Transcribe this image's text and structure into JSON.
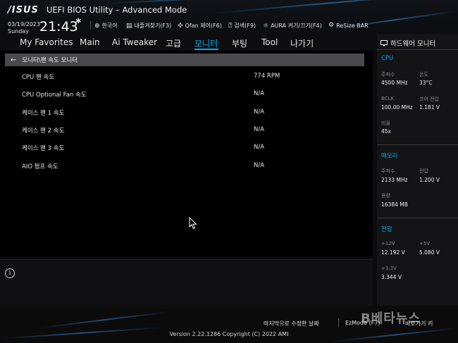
{
  "header": {
    "logo": "/ISUS",
    "title": "UEFI BIOS Utility – Advanced Mode",
    "date": "03/19/2023",
    "day": "Sunday",
    "time": "21:43",
    "icons": {
      "settings": "gear-icon"
    },
    "items": [
      {
        "icon": "globe-icon",
        "label": "한국어"
      },
      {
        "icon": "bookmark-icon",
        "label": "내즐겨찾기(F3)"
      },
      {
        "icon": "fan-icon",
        "label": "Qfan 제어(F6)"
      },
      {
        "icon": "help-icon",
        "label": "검색(F9)"
      },
      {
        "icon": "aura-icon",
        "label": "AURA 켜기/끄기(F4)"
      },
      {
        "icon": "resize-bar-icon",
        "label": "ReSize BAR"
      }
    ]
  },
  "menu": {
    "tabs": [
      "My Favorites",
      "Main",
      "Ai Tweaker",
      "고급",
      "모니터",
      "부팅",
      "Tool",
      "나가기"
    ],
    "active": "모니터"
  },
  "main": {
    "breadcrumb": "모니터\\팬 속도 모니터",
    "rows": [
      {
        "label": "CPU 팬 속도",
        "value": "774 RPM"
      },
      {
        "label": "CPU Optional Fan 속도",
        "value": "N/A"
      },
      {
        "label": "케이스 팬 1 속도",
        "value": "N/A"
      },
      {
        "label": "케이스 팬 2 속도",
        "value": "N/A"
      },
      {
        "label": "케이스 팬 3 속도",
        "value": "N/A"
      },
      {
        "label": "AIO 펌프 속도",
        "value": "N/A"
      }
    ]
  },
  "help": {
    "icon": "info-icon",
    "glyph": "i"
  },
  "hardware_monitor": {
    "title": "하드웨어 모니터",
    "cpu": {
      "title": "CPU",
      "freq_label": "주파수",
      "freq": "4500 MHz",
      "temp_label": "온도",
      "temp": "33°C",
      "bclk_label": "BCLK",
      "bclk": "100.00 MHz",
      "vcore_label": "코어 전압",
      "vcore": "1.181 V",
      "ratio_label": "비율",
      "ratio": "45x"
    },
    "memory": {
      "title": "메모리",
      "freq_label": "주파수",
      "freq": "2133 MHz",
      "volt_label": "전압",
      "volt": "1.200 V",
      "cap_label": "용량",
      "cap": "16384 MB"
    },
    "voltage": {
      "title": "전압",
      "v12_label": "+12V",
      "v12": "12.192 V",
      "v5_label": "+5V",
      "v5": "5.080 V",
      "v33_label": "+3.3V",
      "v33": "3.344 V"
    }
  },
  "footer": {
    "last_modified": "마지막으로 수정한 날짜",
    "ezmode": "EzMode (F7)",
    "hotkeys": "바로가기 키",
    "version": "Version 2.22.1286 Copyright (C) 2022 AMI",
    "watermark": "B베타뉴스"
  },
  "colors": {
    "accent": "#00aaf0",
    "breadcrumb_bg": "#4a4a4c",
    "panel_bg": "#141416"
  }
}
